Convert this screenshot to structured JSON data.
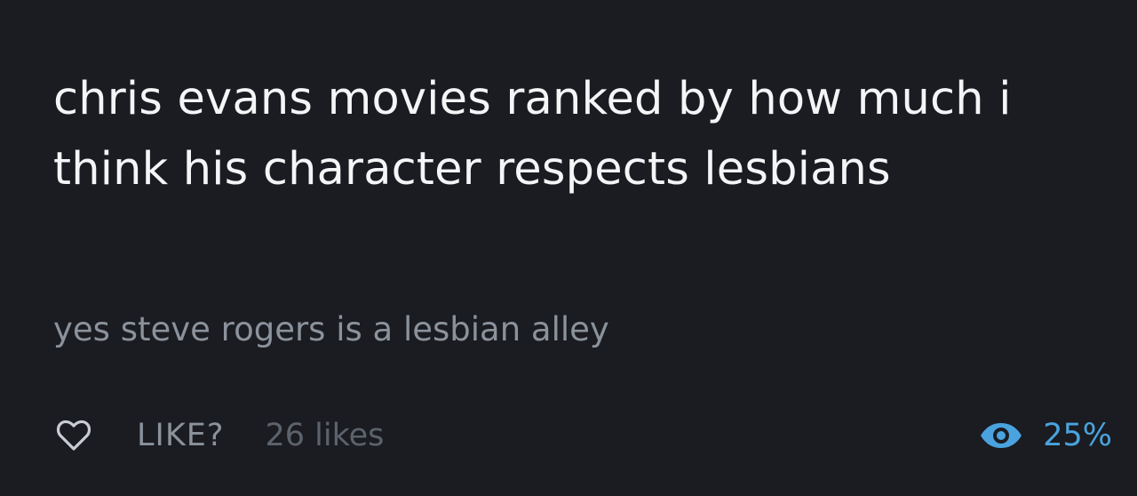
{
  "post": {
    "title": "chris evans movies ranked by how much i think his character respects lesbians",
    "subtitle": "yes steve rogers is a lesbian alley"
  },
  "footer": {
    "like_icon": "heart-outline-icon",
    "like_label": "LIKE?",
    "likes_count": "26 likes",
    "views_icon": "eye-icon",
    "views_percent": "25%",
    "accent_color": "#4aa3df"
  }
}
